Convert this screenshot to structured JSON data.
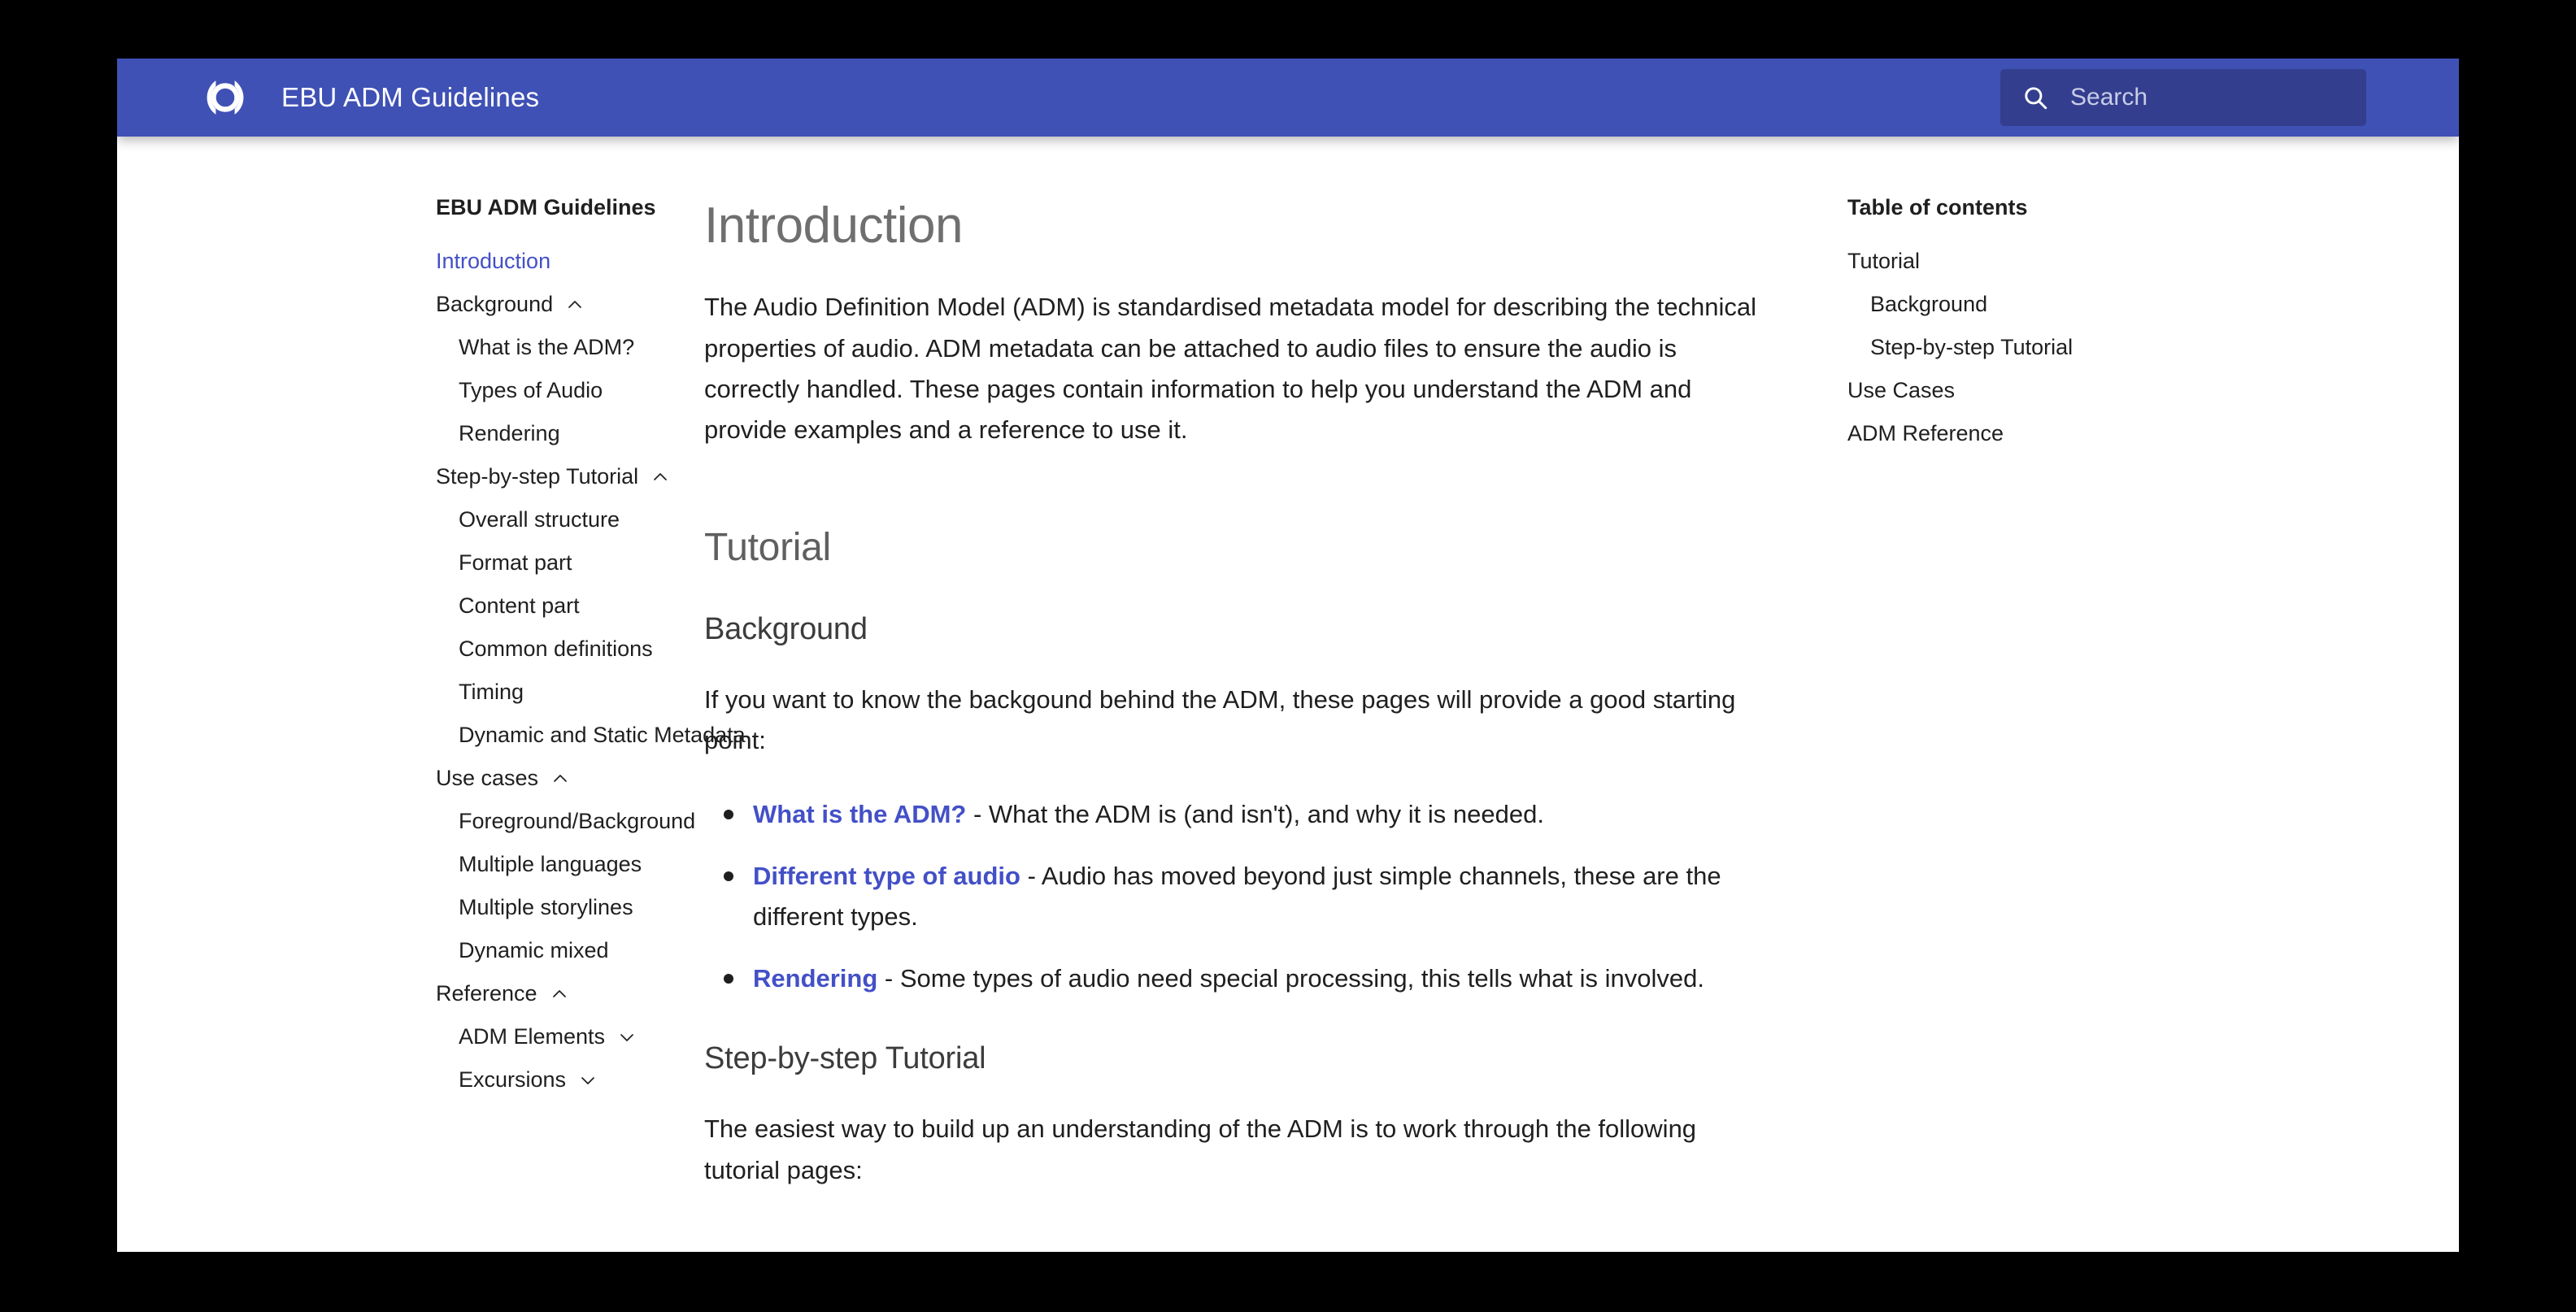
{
  "header": {
    "logo_icon": "ebu-logo-icon",
    "title": "EBU ADM Guidelines",
    "search": {
      "icon": "search-icon",
      "placeholder": "Search",
      "value": ""
    },
    "colors": {
      "bar": "#3f51b5",
      "search_field": "#333e8e",
      "accent_link": "#4350c7"
    }
  },
  "sidebar": {
    "title": "EBU ADM Guidelines",
    "items": [
      {
        "label": "Introduction",
        "level": 1,
        "active": true,
        "chevron": null
      },
      {
        "label": "Background",
        "level": 1,
        "active": false,
        "chevron": "chevron-up-icon"
      },
      {
        "label": "What is the ADM?",
        "level": 2,
        "active": false,
        "chevron": null
      },
      {
        "label": "Types of Audio",
        "level": 2,
        "active": false,
        "chevron": null
      },
      {
        "label": "Rendering",
        "level": 2,
        "active": false,
        "chevron": null
      },
      {
        "label": "Step-by-step Tutorial",
        "level": 1,
        "active": false,
        "chevron": "chevron-up-icon"
      },
      {
        "label": "Overall structure",
        "level": 2,
        "active": false,
        "chevron": null
      },
      {
        "label": "Format part",
        "level": 2,
        "active": false,
        "chevron": null
      },
      {
        "label": "Content part",
        "level": 2,
        "active": false,
        "chevron": null
      },
      {
        "label": "Common definitions",
        "level": 2,
        "active": false,
        "chevron": null
      },
      {
        "label": "Timing",
        "level": 2,
        "active": false,
        "chevron": null
      },
      {
        "label": "Dynamic and Static Metadata",
        "level": 2,
        "active": false,
        "chevron": null
      },
      {
        "label": "Use cases",
        "level": 1,
        "active": false,
        "chevron": "chevron-up-icon"
      },
      {
        "label": "Foreground/Background",
        "level": 2,
        "active": false,
        "chevron": null
      },
      {
        "label": "Multiple languages",
        "level": 2,
        "active": false,
        "chevron": null
      },
      {
        "label": "Multiple storylines",
        "level": 2,
        "active": false,
        "chevron": null
      },
      {
        "label": "Dynamic mixed",
        "level": 2,
        "active": false,
        "chevron": null
      },
      {
        "label": "Reference",
        "level": 1,
        "active": false,
        "chevron": "chevron-up-icon"
      },
      {
        "label": "ADM Elements",
        "level": 2,
        "active": false,
        "chevron": "chevron-down-icon"
      },
      {
        "label": "Excursions",
        "level": 2,
        "active": false,
        "chevron": "chevron-down-icon"
      }
    ]
  },
  "main": {
    "page_title": "Introduction",
    "intro_paragraph": "The Audio Definition Model (ADM) is standardised metadata model for describing the technical properties of audio. ADM metadata can be attached to audio files to ensure the audio is correctly handled. These pages contain information to help you understand the ADM and provide examples and a reference to use it.",
    "tutorial_heading": "Tutorial",
    "background_heading": "Background",
    "background_paragraph": "If you want to know the backgound behind the ADM, these pages will provide a good starting point:",
    "background_list": [
      {
        "link": "What is the ADM?",
        "text": " - What the ADM is (and isn't), and why it is needed."
      },
      {
        "link": "Different type of audio",
        "text": " - Audio has moved beyond just simple channels, these are the different types."
      },
      {
        "link": "Rendering",
        "text": " - Some types of audio need special processing, this tells what is involved."
      }
    ],
    "stepbystep_heading": "Step-by-step Tutorial",
    "stepbystep_paragraph": "The easiest way to build up an understanding of the ADM is to work through the following tutorial pages:"
  },
  "toc": {
    "title": "Table of contents",
    "items": [
      {
        "label": "Tutorial",
        "level": 1
      },
      {
        "label": "Background",
        "level": 2
      },
      {
        "label": "Step-by-step Tutorial",
        "level": 2
      },
      {
        "label": "Use Cases",
        "level": 1
      },
      {
        "label": "ADM Reference",
        "level": 1
      }
    ]
  }
}
